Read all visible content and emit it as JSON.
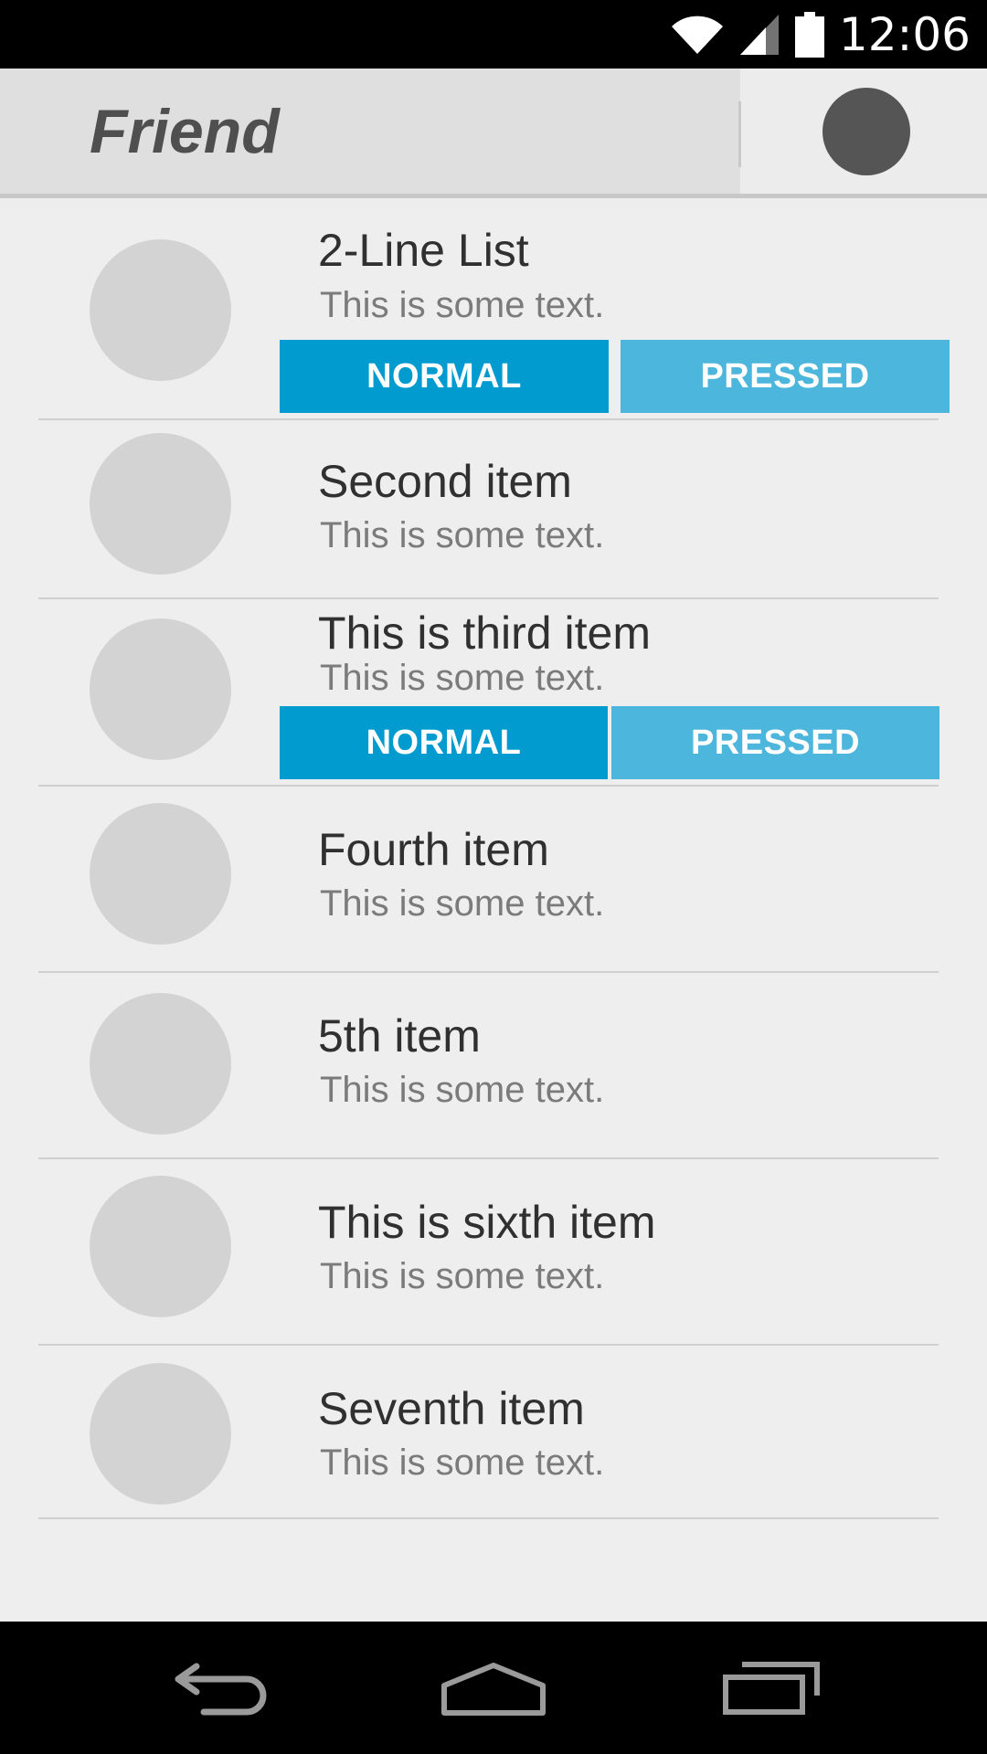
{
  "status_bar": {
    "time": "12:06",
    "icons": [
      "wifi-icon",
      "signal-icon",
      "battery-icon"
    ]
  },
  "action_bar": {
    "title": "Friend",
    "overflow_icon": "overflow-circle-icon"
  },
  "colors": {
    "button_normal": "#029bd0",
    "button_pressed": "#4db6dc",
    "avatar": "#d3d3d3"
  },
  "list": {
    "items": [
      {
        "title": "2-Line List",
        "subtitle": "This is some text.",
        "buttons": {
          "normal": "NORMAL",
          "pressed": "PRESSED"
        }
      },
      {
        "title": "Second item",
        "subtitle": "This is some text."
      },
      {
        "title": "This is third item",
        "subtitle": "This is some text.",
        "buttons": {
          "normal": "NORMAL",
          "pressed": "PRESSED"
        }
      },
      {
        "title": "Fourth item",
        "subtitle": "This is some text."
      },
      {
        "title": "5th item",
        "subtitle": "This is some text."
      },
      {
        "title": "This is sixth item",
        "subtitle": "This is some text."
      },
      {
        "title": "Seventh item",
        "subtitle": "This is some text."
      }
    ]
  },
  "nav_bar": {
    "buttons": [
      "back-icon",
      "home-icon",
      "recents-icon"
    ]
  }
}
